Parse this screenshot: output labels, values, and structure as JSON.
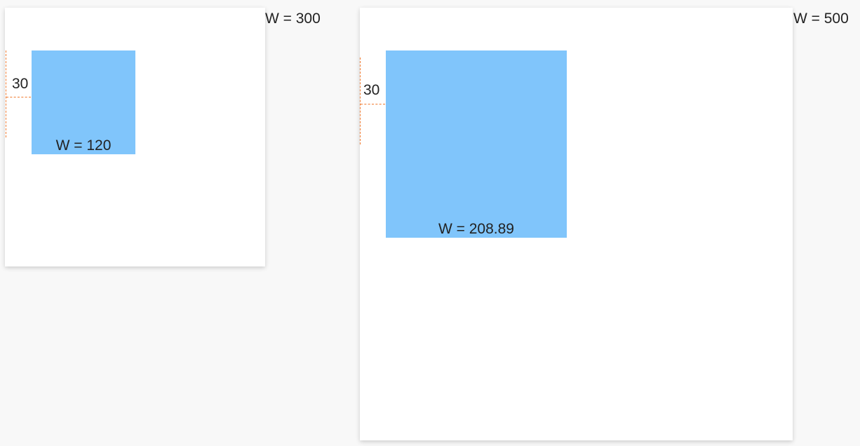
{
  "frames": [
    {
      "width_label": "W = 300",
      "margin_label": "30",
      "box_label": "W = 120"
    },
    {
      "width_label": "W = 500",
      "margin_label": "30",
      "box_label": "W = 208.89"
    }
  ],
  "colors": {
    "background": "#f8f8f8",
    "frame": "#ffffff",
    "box": "#80c5fb",
    "dimension_line": "#f07a30"
  }
}
